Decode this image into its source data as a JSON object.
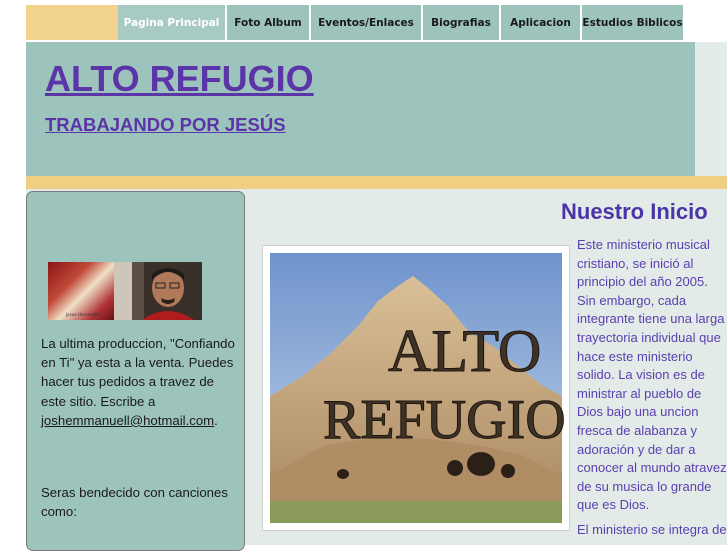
{
  "nav": {
    "tabs": [
      {
        "label": "Pagina Principal",
        "active": true
      },
      {
        "label": "Foto Album"
      },
      {
        "label": "Eventos/Enlaces"
      },
      {
        "label": "Biografias"
      },
      {
        "label": "Aplicacion"
      },
      {
        "label": "Estudios Biblicos"
      }
    ]
  },
  "header": {
    "title": "ALTO REFUGIO",
    "subtitle": "TRABAJANDO POR JESÚS"
  },
  "sidebar": {
    "promo_text": "La ultima produccion, \"Confiando en Ti\" ya esta a la venta.  Puedes hacer tus pedidos a travez de este sitio. Escribe a",
    "email": "joshemmanuell@hotmail.com",
    "email_suffix": ".",
    "blessing_text": "Seras bendecido con canciones como:",
    "album_cover_text": "Josue Hernandez"
  },
  "main": {
    "section_title": "Nuestro Inicio",
    "image_text_line1": "ALTO",
    "image_text_line2": "REFUGIO",
    "paragraph1_lines": [
      "Este ministerio musical",
      "cristiano, se inició al",
      "principio del año 2005.",
      "Sin embargo, cada",
      "integrante tiene una larga",
      "trayectoria individual que",
      "hace este ministerio",
      "solido.  La vision es de",
      "ministrar al pueblo de",
      "Dios bajo una uncion",
      "fresca de alabanza y",
      "adoración y de dar a",
      "conocer al mundo atravez",
      "de su musica lo grande",
      "que es Dios."
    ],
    "paragraph2_lines": [
      "El ministerio se integra de"
    ]
  },
  "colors": {
    "header_bg": "#9dc3bd",
    "gold_accent": "#f0cf82",
    "title_purple": "#5b35a8",
    "body_purple": "#5b3fb0"
  }
}
